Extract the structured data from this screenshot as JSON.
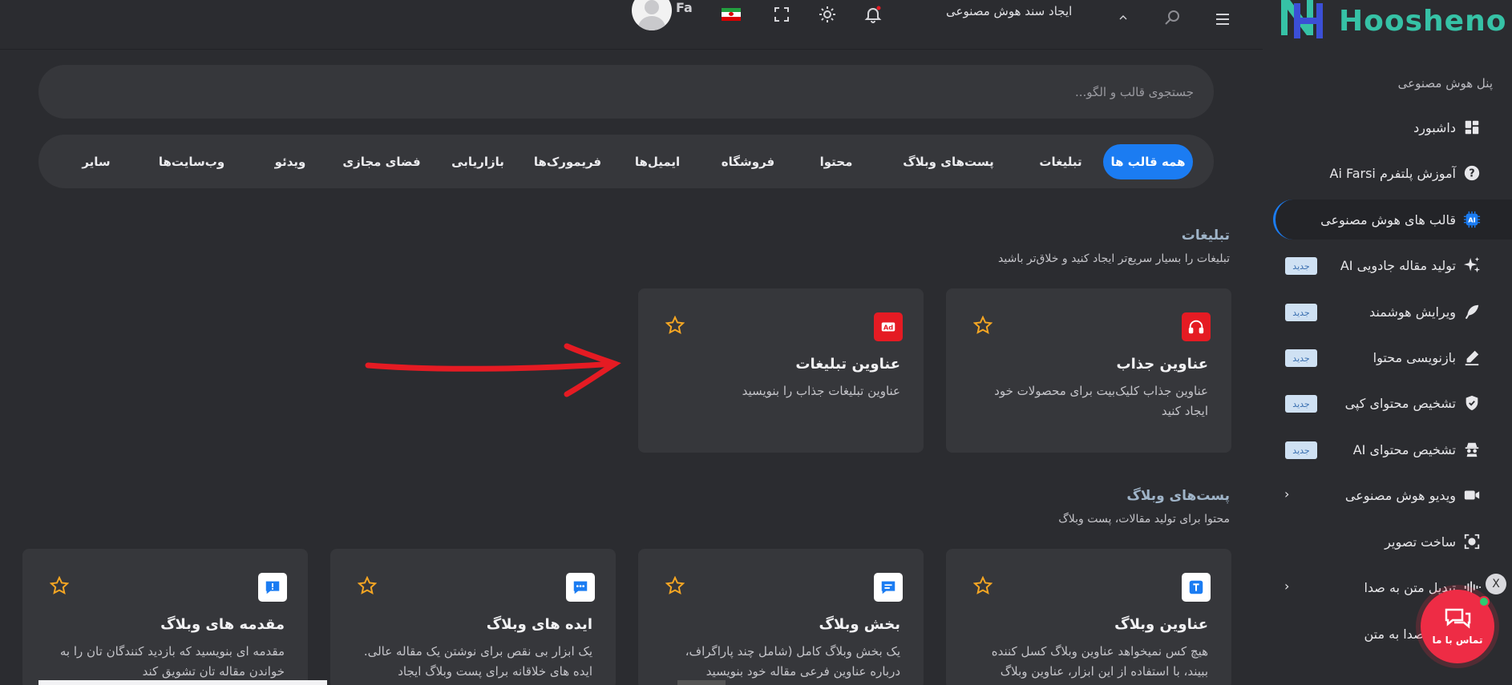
{
  "topbar": {
    "title": "ایجاد سند هوش مصنوعی",
    "lang": "Fa"
  },
  "sidebar": {
    "logo_text": "Hoosheno",
    "panel_title": "پنل هوش مصنوعی",
    "items": [
      {
        "label": "داشبورد",
        "icon": "dashboard-icon"
      },
      {
        "label": "آموزش پلتفرم Ai Farsi",
        "icon": "help-icon"
      },
      {
        "label": "قالب های هوش مصنوعی",
        "icon": "ai-chip-icon"
      },
      {
        "label": "تولید مقاله جادویی AI",
        "icon": "sparkles-icon",
        "badge": "جدید"
      },
      {
        "label": "ویرایش هوشمند",
        "icon": "feather-icon",
        "badge": "جدید"
      },
      {
        "label": "بازنویسی محتوا",
        "icon": "pencil-icon",
        "badge": "جدید"
      },
      {
        "label": "تشخیص محتوای کپی",
        "icon": "shield-icon",
        "badge": "جدید"
      },
      {
        "label": "تشخیص محتوای AI",
        "icon": "spy-icon",
        "badge": "جدید"
      },
      {
        "label": "ویدیو هوش مصنوعی",
        "icon": "video-icon",
        "chevron": "›"
      },
      {
        "label": "ساخت تصویر",
        "icon": "image-scan-icon"
      },
      {
        "label": "تبدیل متن به صدا",
        "icon": "audio-wave-icon",
        "chevron": "›"
      },
      {
        "label": "تبدیل صدا به متن",
        "icon": "mic-icon"
      }
    ]
  },
  "search": {
    "placeholder": "جستجوی قالب و الگو..."
  },
  "tabs": [
    "همه قالب ها",
    "تبلیغات",
    "پست‌های وبلاگ",
    "محتوا",
    "فروشگاه",
    "ایمیل‌ها",
    "فریمورک‌ها",
    "بازاریابی",
    "فضای مجازی",
    "ویدئو",
    "وب‌سایت‌ها",
    "سایر"
  ],
  "sections": {
    "ads": {
      "title": "تبلیغات",
      "subtitle": "تبلیغات را بسیار سریع‌تر ایجاد کنید و خلاق‌تر باشید",
      "cards": [
        {
          "title": "عناوین جذاب",
          "desc": "عناوین جذاب کلیک‌بیت برای محصولات خود ایجاد کنید",
          "icon": "headphones-icon",
          "color": "#e51b23"
        },
        {
          "title": "عناوین تبلیغات",
          "desc": "عناوین تبلیغات جذاب را بنویسید",
          "icon": "ad-icon",
          "color": "#e51b23"
        }
      ]
    },
    "blog": {
      "title": "پست‌های وبلاگ",
      "subtitle": "محتوا برای تولید مقالات، پست وبلاگ",
      "cards": [
        {
          "title": "عناوین وبلاگ",
          "desc": "هیچ کس نمیخواهد عناوین وبلاگ کسل کننده ببیند، با استفاده از این ابزار، عناوین وبلاگ",
          "icon": "text-icon",
          "color": "#1b7cf2"
        },
        {
          "title": "بخش وبلاگ",
          "desc": "یک بخش وبلاگ کامل (شامل چند پاراگراف، درباره عناوین فرعی مقاله خود بنویسید",
          "icon": "comment-lines-icon",
          "color": "#1b7cf2"
        },
        {
          "title": "ایده های وبلاگ",
          "desc": "یک ابزار بی نقص برای نوشتن یک مقاله عالی. ایده های خلاقانه برای پست وبلاگ ایجاد",
          "icon": "comment-dots-icon",
          "color": "#1b7cf2"
        },
        {
          "title": "مقدمه های وبلاگ",
          "desc": "مقدمه ای بنویسید که بازدید کنندگان تان را به خواندن مقاله تان تشویق کند",
          "icon": "comment-exclaim-icon",
          "color": "#1b7cf2"
        }
      ]
    }
  },
  "chat": {
    "label": "تماس با ما",
    "close": "X"
  },
  "colors": {
    "accent": "#1b7cf2",
    "brand": "#36c2a6",
    "star": "#f5a623",
    "badge_bg": "#cfe1f3"
  }
}
